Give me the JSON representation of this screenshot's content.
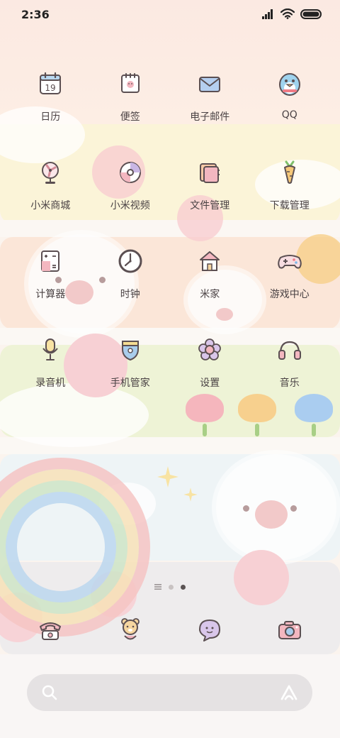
{
  "status_bar": {
    "time": "2:36"
  },
  "home_apps": [
    {
      "label": "日历",
      "icon": "calendar-icon",
      "day": "19"
    },
    {
      "label": "便签",
      "icon": "notes-icon"
    },
    {
      "label": "电子邮件",
      "icon": "mail-icon"
    },
    {
      "label": "QQ",
      "icon": "penguin-icon"
    },
    {
      "label": "小米商城",
      "icon": "fan-icon"
    },
    {
      "label": "小米视频",
      "icon": "video-disc-icon"
    },
    {
      "label": "文件管理",
      "icon": "folder-icon"
    },
    {
      "label": "下载管理",
      "icon": "carrot-icon"
    },
    {
      "label": "计算器",
      "icon": "calculator-icon"
    },
    {
      "label": "时钟",
      "icon": "clock-icon"
    },
    {
      "label": "米家",
      "icon": "house-icon"
    },
    {
      "label": "游戏中心",
      "icon": "gamepad-icon"
    },
    {
      "label": "录音机",
      "icon": "microphone-icon"
    },
    {
      "label": "手机管家",
      "icon": "shield-icon"
    },
    {
      "label": "设置",
      "icon": "flower-gear-icon"
    },
    {
      "label": "音乐",
      "icon": "headphones-icon"
    }
  ],
  "page_indicator": {
    "pages": 3,
    "active_page": 3
  },
  "dock_apps": [
    {
      "icon": "phone-icon"
    },
    {
      "icon": "contacts-bear-icon"
    },
    {
      "icon": "message-icon"
    },
    {
      "icon": "camera-icon"
    }
  ],
  "colors": {
    "label_text": "#4a4244",
    "icon_stroke": "#5b4f52",
    "accent_pink": "#f3b7c0",
    "accent_blue": "#a9cdec",
    "accent_yellow": "#f6dd92"
  }
}
